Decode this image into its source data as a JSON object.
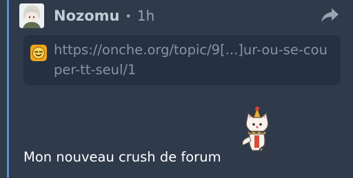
{
  "post": {
    "author": "Nozomu",
    "separator": "•",
    "time": "1h",
    "link": {
      "text": "https://onche.org/topic/9[...]ur-ou-se-couper-tt-seul/1"
    },
    "message": "Mon nouveau crush de forum"
  },
  "icons": {
    "share": "share-arrow-icon",
    "favicon": "smiley-favicon-icon",
    "sticker": "clown-cat-sticker"
  },
  "colors": {
    "background": "#2f3a4b",
    "quote_bar": "#5b8fd6",
    "author": "#c3ccd6",
    "muted": "#9aa4b1",
    "card": "#253142",
    "link": "#8794a3",
    "message": "#ffffff"
  }
}
